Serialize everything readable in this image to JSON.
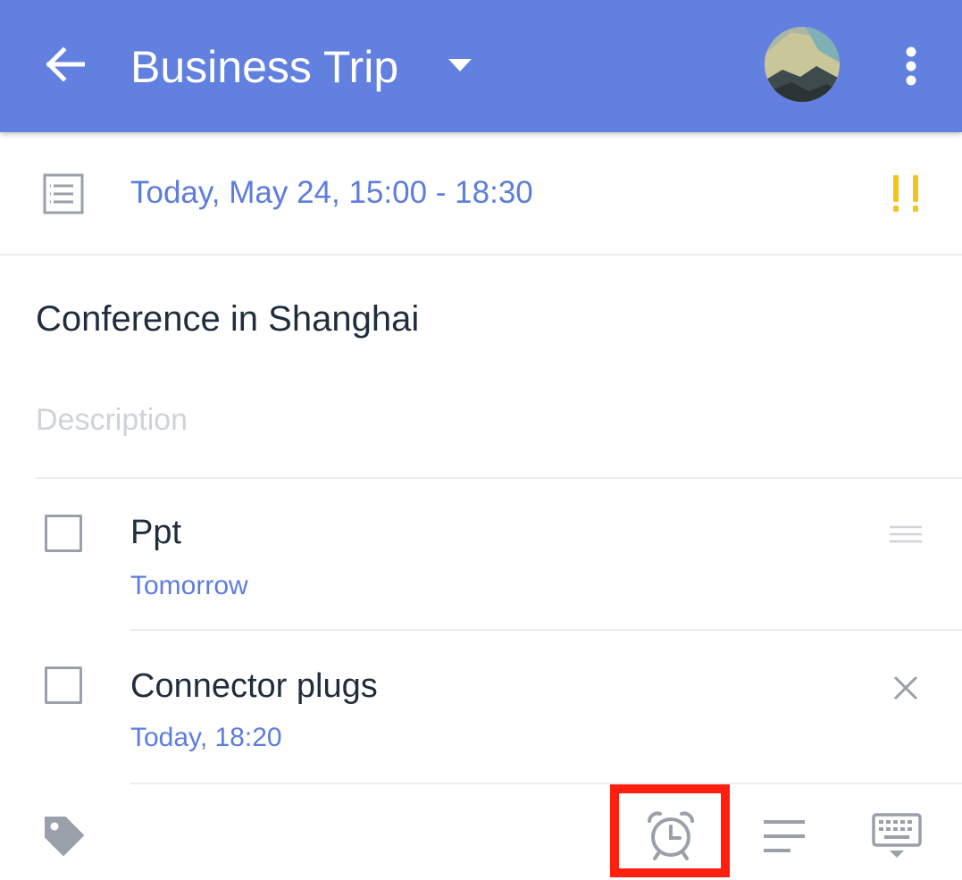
{
  "header": {
    "title": "Business Trip"
  },
  "task": {
    "date": "Today, May 24, 15:00 - 18:30",
    "priority_mark": "!!",
    "title": "Conference in Shanghai",
    "description_placeholder": "Description"
  },
  "checklist": [
    {
      "label": "Ppt",
      "due": "Tomorrow",
      "checked": false
    },
    {
      "label": "Connector plugs",
      "due": "Today, 18:20",
      "checked": false
    }
  ],
  "colors": {
    "appbar": "#6180e0",
    "accent": "#5d7ce0",
    "priority": "#f6c21c",
    "highlight": "#ff1f0f"
  },
  "icons": {
    "back": "arrow-left-icon",
    "dropdown": "caret-down-icon",
    "more": "more-vertical-icon",
    "note": "note-icon",
    "drag": "drag-handle-icon",
    "remove": "close-icon",
    "tag": "tag-icon",
    "reminder": "alarm-clock-icon",
    "description": "text-lines-icon",
    "keyboard": "keyboard-hide-icon"
  }
}
